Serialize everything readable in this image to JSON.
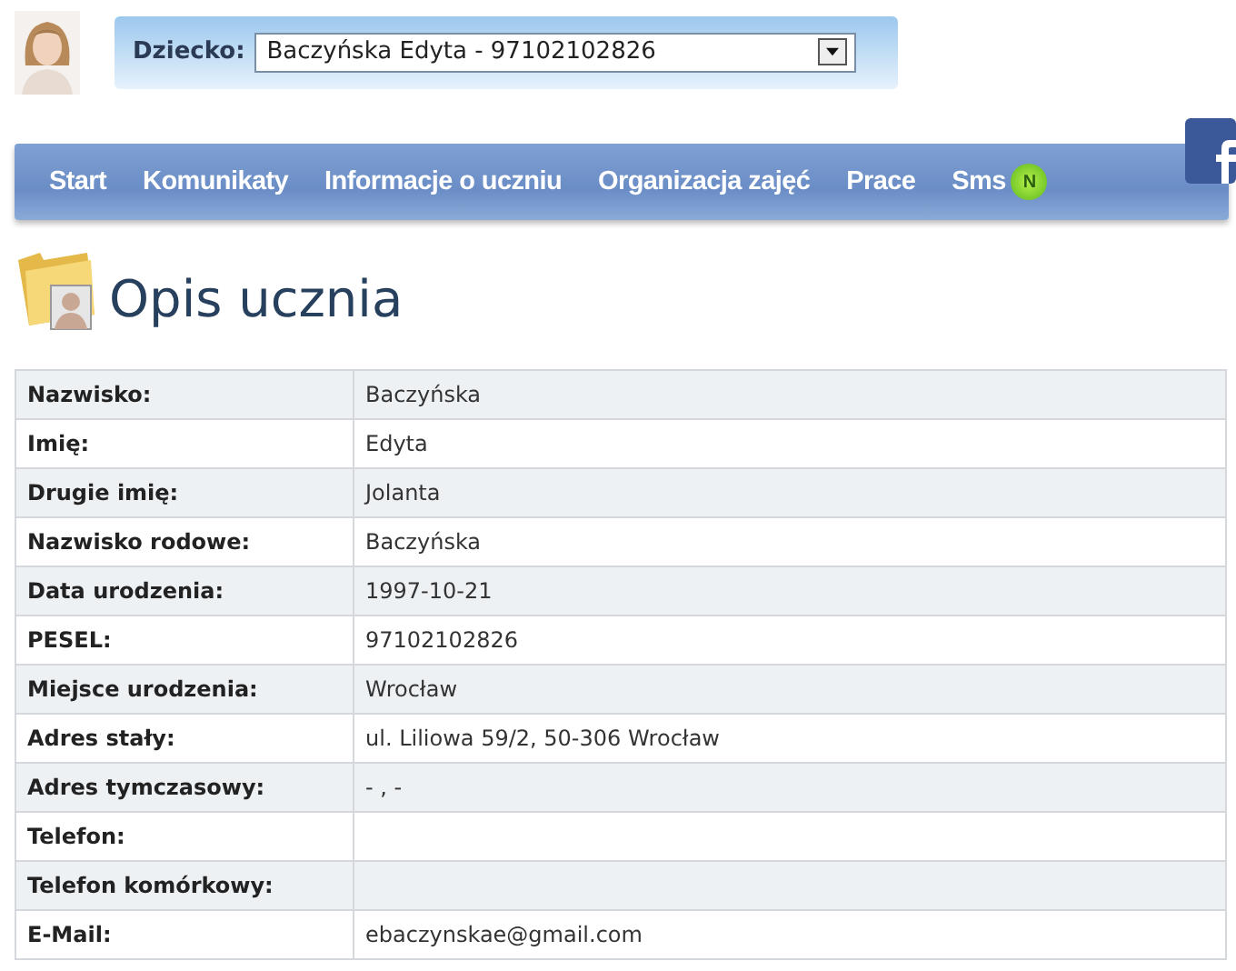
{
  "child_selector": {
    "label": "Dziecko:",
    "value": "Baczyńska Edyta - 97102102826"
  },
  "nav": [
    {
      "label": "Start"
    },
    {
      "label": "Komunikaty"
    },
    {
      "label": "Informacje o uczniu"
    },
    {
      "label": "Organizacja zajęć"
    },
    {
      "label": "Prace"
    },
    {
      "label": "Sms",
      "badge": "N"
    }
  ],
  "title": "Opis ucznia",
  "details": [
    {
      "label": "Nazwisko:",
      "value": "Baczyńska"
    },
    {
      "label": "Imię:",
      "value": "Edyta"
    },
    {
      "label": "Drugie imię:",
      "value": "Jolanta"
    },
    {
      "label": "Nazwisko rodowe:",
      "value": "Baczyńska"
    },
    {
      "label": "Data urodzenia:",
      "value": "1997-10-21"
    },
    {
      "label": "PESEL:",
      "value": "97102102826"
    },
    {
      "label": "Miejsce urodzenia:",
      "value": "Wrocław"
    },
    {
      "label": "Adres stały:",
      "value": "ul. Liliowa 59/2, 50-306 Wrocław"
    },
    {
      "label": "Adres tymczasowy:",
      "value": "- , -"
    },
    {
      "label": "Telefon:"
    },
    {
      "label": "Telefon komórkowy:"
    },
    {
      "label": "E-Mail:",
      "value": "ebaczynskae@gmail.com"
    }
  ]
}
